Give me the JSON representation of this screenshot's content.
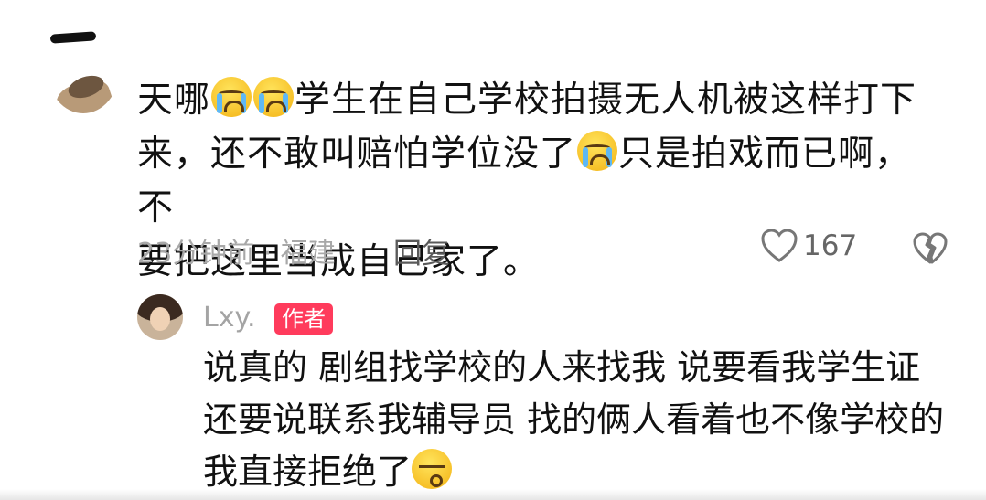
{
  "comment": {
    "text_parts": [
      "天哪",
      "学生在自己学校拍摄无人机被这样打下\n来，还不敢叫赔怕学位没了",
      "只是拍戏而已啊，不\n要把这里当成自己家了。"
    ],
    "emoji": "loudly-crying-face",
    "time_location": "23分钟前 · 福建",
    "reply_label": "回复",
    "like_count": "167"
  },
  "reply": {
    "username": "Lxy.",
    "badge": "作者",
    "text_part1": "说真的 剧组找学校的人来找我 说要看我学生证\n还要说联系我辅导员 找的俩人看着也不像学校的\n我直接拒绝了",
    "emoji": "sighing-face"
  },
  "colors": {
    "badge": "#ff3b5c",
    "meta_text": "#a8a8a8",
    "primary_text": "#111111"
  }
}
